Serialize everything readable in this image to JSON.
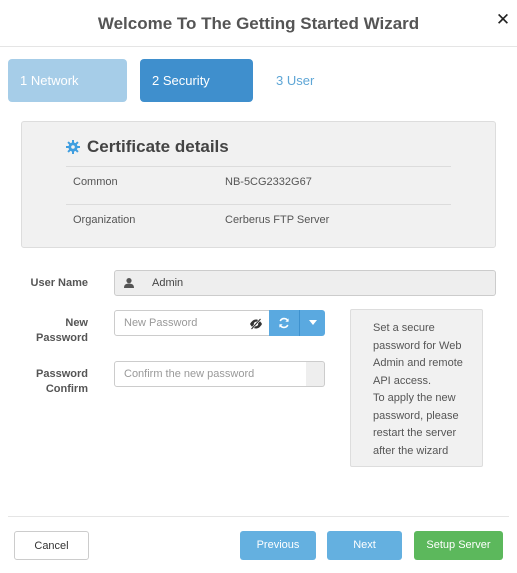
{
  "header": {
    "title": "Welcome To The Getting Started Wizard",
    "close_icon": "close-icon"
  },
  "steps": [
    {
      "label": "1 Network",
      "state": "completed"
    },
    {
      "label": "2 Security",
      "state": "active"
    },
    {
      "label": "3 User",
      "state": "upcoming"
    }
  ],
  "certificate": {
    "icon": "gear-icon",
    "title": "Certificate details",
    "rows": [
      {
        "key": "Common",
        "value": "NB-5CG2332G67"
      },
      {
        "key": "Organization",
        "value": "Cerberus FTP Server"
      }
    ]
  },
  "form": {
    "user_name": {
      "label": "User Name",
      "value": "Admin",
      "icon": "user-icon"
    },
    "new_password": {
      "label_line1": "New",
      "label_line2": "Password",
      "placeholder": "New Password",
      "value": ""
    },
    "password_confirm": {
      "label_line1": "Password",
      "label_line2": "Confirm",
      "placeholder": "Confirm the new password",
      "value": ""
    },
    "icons": {
      "eye": "eye-slash-icon",
      "refresh": "refresh-icon",
      "caret": "caret-down-icon"
    }
  },
  "help": {
    "lines": [
      "Set a secure",
      "password for Web",
      "Admin and remote",
      "API access.",
      "To apply the new",
      "password, please",
      "restart the server",
      "after the wizard"
    ]
  },
  "footer": {
    "cancel_label": "Cancel",
    "previous_label": "Previous",
    "next_label": "Next",
    "setup_label": "Setup Server"
  },
  "colors": {
    "step_completed": "#a6cde8",
    "step_active": "#3f8fcd",
    "primary_button": "#64b0e0",
    "success_button": "#5cb85c",
    "cert_icon": "#3f9ee0"
  }
}
